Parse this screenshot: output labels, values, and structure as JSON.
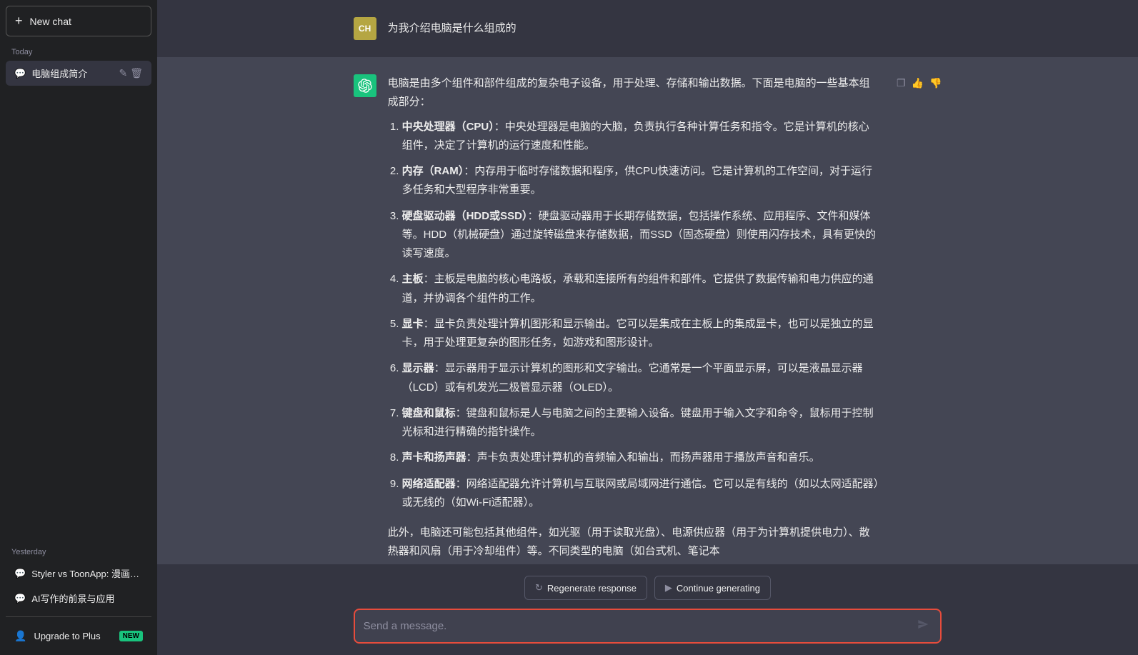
{
  "sidebar": {
    "new_chat_label": "New chat",
    "today_label": "Today",
    "yesterday_label": "Yesterday",
    "today_chats": [
      {
        "id": "chat-1",
        "label": "电脑组成简介",
        "active": true
      }
    ],
    "yesterday_chats": [
      {
        "id": "chat-2",
        "label": "Styler vs ToonApp: 漫画脸优..."
      },
      {
        "id": "chat-3",
        "label": "AI写作的前景与应用"
      }
    ],
    "upgrade_label": "Upgrade to Plus",
    "new_badge": "NEW"
  },
  "chat": {
    "user_avatar": "CH",
    "user_question": "为我介绍电脑是什么组成的",
    "ai_intro": "电脑是由多个组件和部件组成的复杂电子设备，用于处理、存储和输出数据。下面是电脑的一些基本组成部分：",
    "ai_items": [
      {
        "num": 1,
        "title": "中央处理器（CPU）",
        "text": "中央处理器是电脑的大脑，负责执行各种计算任务和指令。它是计算机的核心组件，决定了计算机的运行速度和性能。"
      },
      {
        "num": 2,
        "title": "内存（RAM）",
        "text": "内存用于临时存储数据和程序，供CPU快速访问。它是计算机的工作空间，对于运行多任务和大型程序非常重要。"
      },
      {
        "num": 3,
        "title": "硬盘驱动器（HDD或SSD）",
        "text": "硬盘驱动器用于长期存储数据，包括操作系统、应用程序、文件和媒体等。HDD（机械硬盘）通过旋转磁盘来存储数据，而SSD（固态硬盘）则使用闪存技术，具有更快的读写速度。"
      },
      {
        "num": 4,
        "title": "主板",
        "text": "主板是电脑的核心电路板，承载和连接所有的组件和部件。它提供了数据传输和电力供应的通道，并协调各个组件的工作。"
      },
      {
        "num": 5,
        "title": "显卡",
        "text": "显卡负责处理计算机图形和显示输出。它可以是集成在主板上的集成显卡，也可以是独立的显卡，用于处理更复杂的图形任务，如游戏和图形设计。"
      },
      {
        "num": 6,
        "title": "显示器",
        "text": "显示器用于显示计算机的图形和文字输出。它通常是一个平面显示屏，可以是液晶显示器（LCD）或有机发光二极管显示器（OLED）。"
      },
      {
        "num": 7,
        "title": "键盘和鼠标",
        "text": "键盘和鼠标是人与电脑之间的主要输入设备。键盘用于输入文字和命令，鼠标用于控制光标和进行精确的指针操作。"
      },
      {
        "num": 8,
        "title": "声卡和扬声器",
        "text": "声卡负责处理计算机的音频输入和输出，而扬声器用于播放声音和音乐。"
      },
      {
        "num": 9,
        "title": "网络适配器",
        "text": "网络适配器允许计算机与互联网或局域网进行通信。它可以是有线的（如以太网适配器）或无线的（如Wi-Fi适配器）。"
      }
    ],
    "ai_footer": "此外，电脑还可能包括其他组件，如光驱（用于读取光盘）、电源供应器（用于为计算机提供电力）、散热器和风扇（用于冷却组件）等。不同类型的电脑（如台式机、笔记本"
  },
  "actions": {
    "regenerate_label": "Regenerate response",
    "continue_label": "Continue generating"
  },
  "input": {
    "placeholder": "Send a message."
  }
}
